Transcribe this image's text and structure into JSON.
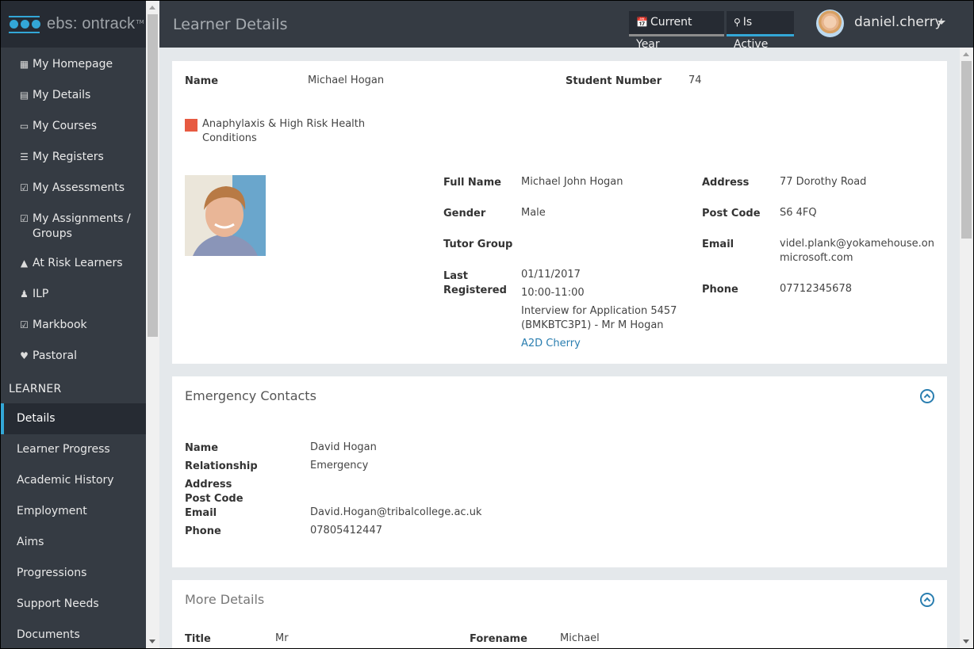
{
  "app": {
    "logo_text": "ebs: ontrack",
    "logo_tm": "TM",
    "accent_color": "#33a7d7"
  },
  "sidebar": {
    "items": [
      {
        "label": "My Homepage",
        "icon": "homepage-icon"
      },
      {
        "label": "My Details",
        "icon": "id-card-icon"
      },
      {
        "label": "My Courses",
        "icon": "book-icon"
      },
      {
        "label": "My Registers",
        "icon": "list-icon"
      },
      {
        "label": "My Assessments",
        "icon": "checkbox-icon"
      },
      {
        "label": "My Assignments / Groups",
        "icon": "checkbox-icon"
      },
      {
        "label": "At Risk Learners",
        "icon": "warning-icon"
      },
      {
        "label": "ILP",
        "icon": "user-check-icon"
      },
      {
        "label": "Markbook",
        "icon": "clipboard-icon"
      },
      {
        "label": "Pastoral",
        "icon": "heart-icon"
      }
    ],
    "section_label": "LEARNER",
    "learner_items": [
      {
        "label": "Details",
        "active": true
      },
      {
        "label": "Learner Progress"
      },
      {
        "label": "Academic History"
      },
      {
        "label": "Employment"
      },
      {
        "label": "Aims"
      },
      {
        "label": "Progressions"
      },
      {
        "label": "Support Needs"
      },
      {
        "label": "Documents"
      }
    ]
  },
  "header": {
    "title": "Learner Details",
    "filters": [
      {
        "label": "Current Year",
        "icon": "calendar-icon"
      },
      {
        "label": "Is Active",
        "icon": "lightbulb-icon",
        "active": true
      }
    ],
    "user": "daniel.cherry"
  },
  "learner": {
    "name_label": "Name",
    "name": "Michael Hogan",
    "student_number_label": "Student Number",
    "student_number": "74",
    "alert": {
      "text": "Anaphylaxis & High Risk Health Conditions",
      "color": "#e75a41"
    },
    "full_name_label": "Full Name",
    "full_name": "Michael John Hogan",
    "gender_label": "Gender",
    "gender": "Male",
    "tutor_group_label": "Tutor Group",
    "tutor_group": "",
    "last_registered_label": "Last Registered",
    "last_registered": {
      "date": "01/11/2017",
      "time": "10:00-11:00",
      "event": "Interview for Application 5457 (BMKBTC3P1) - Mr M Hogan",
      "link": "A2D Cherry"
    },
    "address_label": "Address",
    "address": "77 Dorothy Road",
    "post_code_label": "Post Code",
    "post_code": "S6 4FQ",
    "email_label": "Email",
    "email": "videl.plank@yokamehouse.onmicrosoft.com",
    "phone_label": "Phone",
    "phone": "07712345678"
  },
  "emergency": {
    "title": "Emergency Contacts",
    "rows": [
      {
        "label": "Name",
        "value": "David Hogan"
      },
      {
        "label": "Relationship",
        "value": "Emergency"
      },
      {
        "label": "Address",
        "value": ""
      },
      {
        "label": "Post Code",
        "value": ""
      },
      {
        "label": "Email",
        "value": "David.Hogan@tribalcollege.ac.uk"
      },
      {
        "label": "Phone",
        "value": "07805412447"
      }
    ]
  },
  "more_details": {
    "title": "More Details",
    "title_label": "Title",
    "title_value": "Mr",
    "forename_label": "Forename",
    "forename_value": "Michael"
  }
}
